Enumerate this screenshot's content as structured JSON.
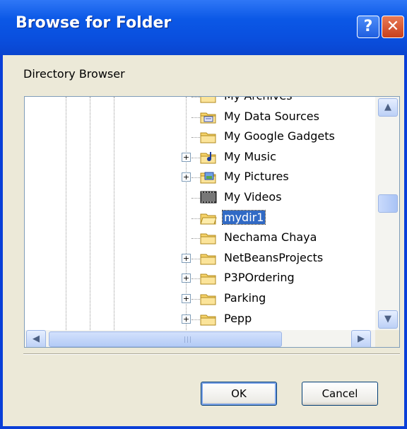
{
  "window": {
    "title": "Browse for Folder",
    "help_label": "?",
    "close_label": "✕"
  },
  "dialog": {
    "description": "Directory Browser"
  },
  "tree": {
    "items": [
      {
        "label": "My Archives",
        "icon": "folder-icon",
        "expandable": false,
        "selected": false
      },
      {
        "label": "My Data Sources",
        "icon": "data-sources-folder-icon",
        "expandable": false,
        "selected": false
      },
      {
        "label": "My Google Gadgets",
        "icon": "folder-icon",
        "expandable": false,
        "selected": false
      },
      {
        "label": "My Music",
        "icon": "music-folder-icon",
        "expandable": true,
        "selected": false
      },
      {
        "label": "My Pictures",
        "icon": "pictures-folder-icon",
        "expandable": true,
        "selected": false
      },
      {
        "label": "My Videos",
        "icon": "videos-folder-icon",
        "expandable": false,
        "selected": false
      },
      {
        "label": "mydir1",
        "icon": "folder-open-icon",
        "expandable": false,
        "selected": true
      },
      {
        "label": "Nechama Chaya",
        "icon": "folder-icon",
        "expandable": false,
        "selected": false
      },
      {
        "label": "NetBeansProjects",
        "icon": "folder-icon",
        "expandable": true,
        "selected": false
      },
      {
        "label": "P3POrdering",
        "icon": "folder-icon",
        "expandable": true,
        "selected": false
      },
      {
        "label": "Parking",
        "icon": "folder-icon",
        "expandable": true,
        "selected": false
      },
      {
        "label": "Pepp",
        "icon": "folder-icon",
        "expandable": true,
        "selected": false
      }
    ],
    "vertical_scroll_position": 0.45
  },
  "buttons": {
    "ok": "OK",
    "cancel": "Cancel"
  },
  "colors": {
    "title_bar": "#0a58e6",
    "selection": "#316ac5",
    "dialog_face": "#ece9d8"
  }
}
